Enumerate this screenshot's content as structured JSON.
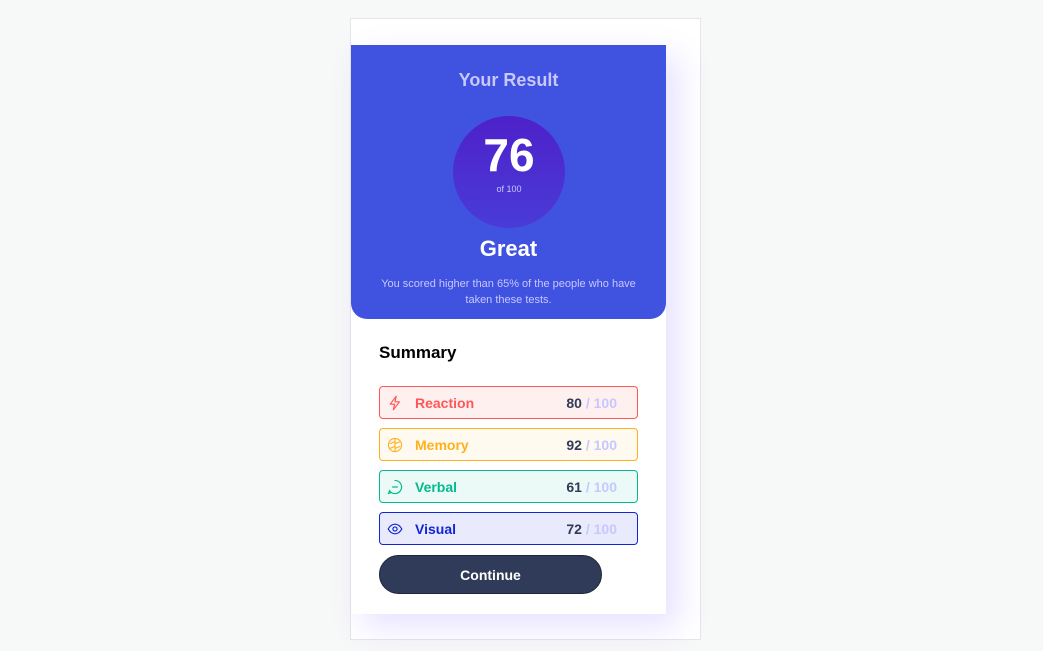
{
  "result": {
    "title": "Your Result",
    "score": "76",
    "score_of": "of 100",
    "verdict": "Great",
    "description": "You scored higher than 65% of the people who have taken these tests."
  },
  "summary": {
    "title": "Summary",
    "items": [
      {
        "label": "Reaction",
        "score": "80",
        "max": "/ 100",
        "icon": "lightning-icon",
        "color": "#ff5757",
        "bg": "#fff0f0"
      },
      {
        "label": "Memory",
        "score": "92",
        "max": "/ 100",
        "icon": "brain-icon",
        "color": "#ffb01f",
        "bg": "#fffaef"
      },
      {
        "label": "Verbal",
        "score": "61",
        "max": "/ 100",
        "icon": "chat-bubble-icon",
        "color": "#00bb8f",
        "bg": "#ebfaf6"
      },
      {
        "label": "Visual",
        "score": "72",
        "max": "/ 100",
        "icon": "eye-icon",
        "color": "#1125d6",
        "bg": "#e9eafb"
      }
    ]
  },
  "continue_label": "Continue",
  "colors": {
    "result_bg": "#4052e0",
    "lavender": "#c8c7ff",
    "dark_navy": "#303b59"
  }
}
